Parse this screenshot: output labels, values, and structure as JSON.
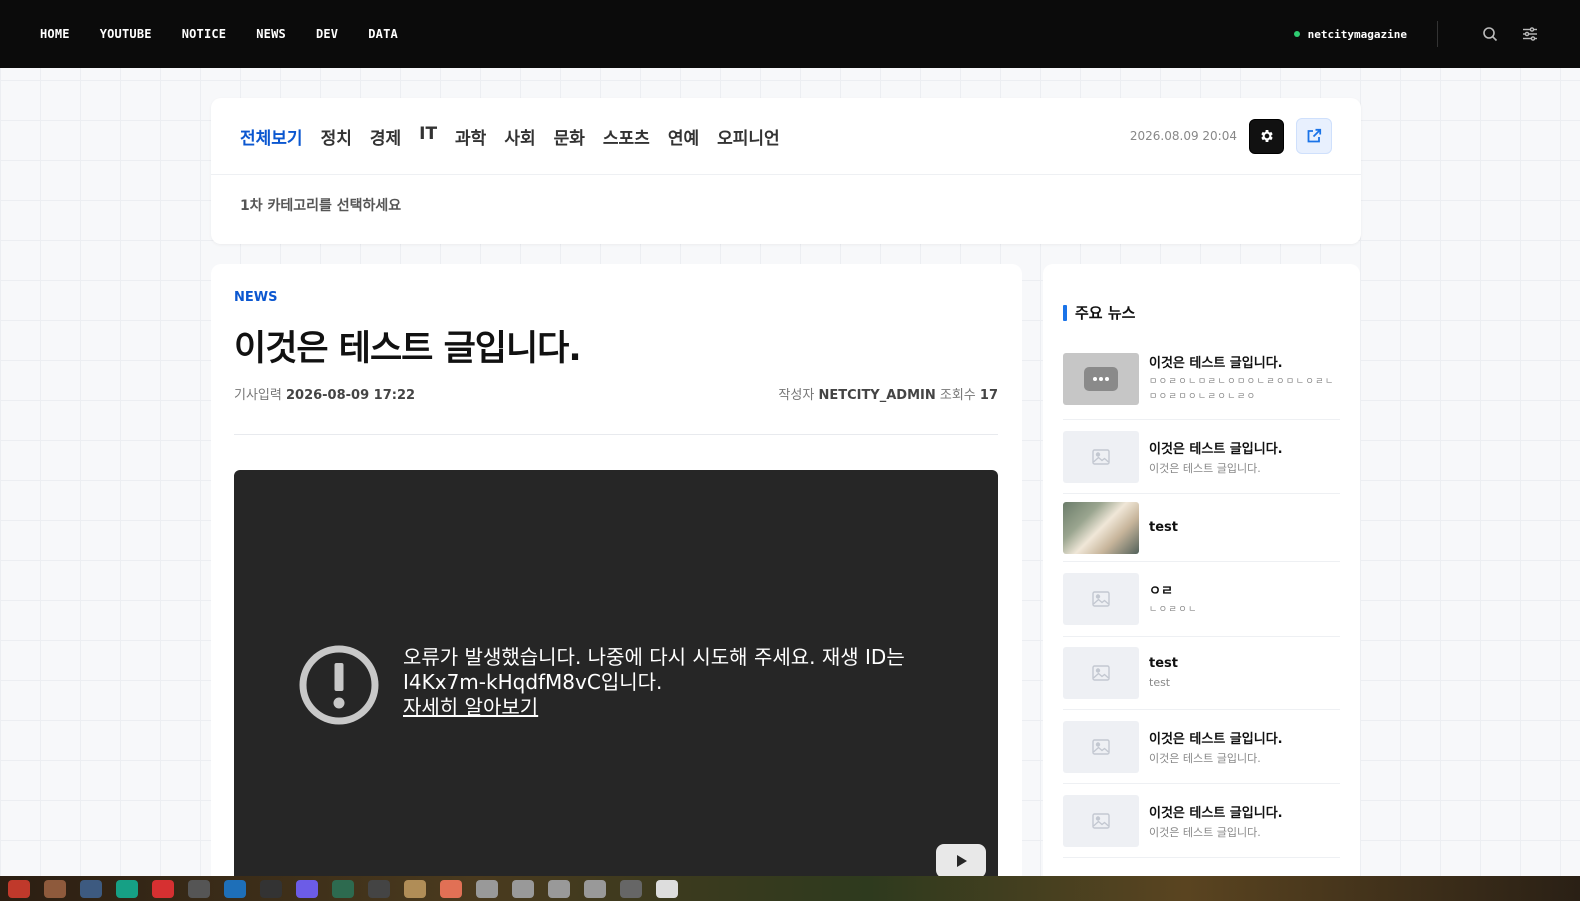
{
  "topnav": {
    "items": [
      "HOME",
      "YOUTUBE",
      "NOTICE",
      "NEWS",
      "DEV",
      "DATA"
    ],
    "site_name": "netcitymagazine",
    "icons": [
      "search-icon",
      "sliders-icon"
    ]
  },
  "category": {
    "tabs": [
      "전체보기",
      "정치",
      "경제",
      "IT",
      "과학",
      "사회",
      "문화",
      "스포츠",
      "연예",
      "오피니언"
    ],
    "active_tab": "전체보기",
    "date": "2026.08.09 20:04",
    "hint": "1차 카테고리를 선택하세요",
    "icons": [
      "gear-icon",
      "external-link-icon"
    ]
  },
  "article": {
    "label": "NEWS",
    "title": "이것은 테스트 글입니다.",
    "input_label": "기사입력",
    "input_date": "2026-08-09 17:22",
    "author_label": "작성자",
    "author": "NETCITY_ADMIN",
    "views_label": "조회수",
    "views": "17",
    "video": {
      "error_line1": "오류가 발생했습니다. 나중에 다시 시도해 주세요. 재생 ID는",
      "error_line2": "I4Kx7m-kHqdfM8vC입니다.",
      "learn_more": "자세히 알아보기"
    }
  },
  "sidebar": {
    "heading": "주요 뉴스",
    "items": [
      {
        "title": "이것은 테스트 글입니다.",
        "sub": "ㅁㅇㄹㅇㄴㅁㄹㄴㅇㅁㅇㄴㄹㅇㅁㄴㅇㄹㄴㅁㅇㄹㅁㅇㄴㄹㅇㄴㄹㅇ",
        "thumb": "chat"
      },
      {
        "title": "이것은 테스트 글입니다.",
        "sub": "이것은 테스트 글입니다.",
        "thumb": "placeholder"
      },
      {
        "title": "test",
        "sub": "",
        "thumb": "photo"
      },
      {
        "title": "ㅇㄹ",
        "sub": "ㄴㅇㄹㅇㄴ",
        "thumb": "placeholder"
      },
      {
        "title": "test",
        "sub": "test",
        "thumb": "placeholder"
      },
      {
        "title": "이것은 테스트 글입니다.",
        "sub": "이것은 테스트 글입니다.",
        "thumb": "placeholder"
      },
      {
        "title": "이것은 테스트 글입니다.",
        "sub": "이것은 테스트 글입니다.",
        "thumb": "placeholder"
      }
    ]
  }
}
